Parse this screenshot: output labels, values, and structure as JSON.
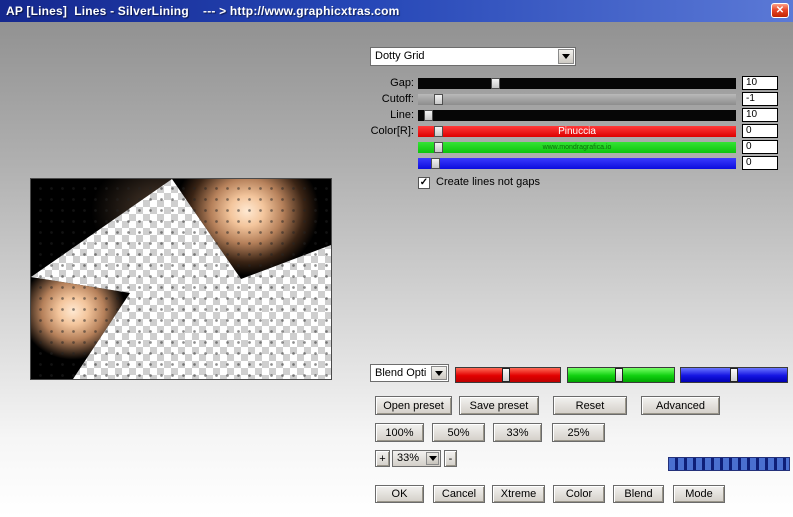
{
  "window": {
    "title": "AP [Lines]  Lines - SilverLining    --- > http://www.graphicxtras.com",
    "close_glyph": "✕"
  },
  "preset_dropdown": {
    "value": "Dotty Grid"
  },
  "sliders": {
    "rows": [
      {
        "label": "Gap:",
        "value": "10",
        "watermark": "",
        "thumb_pct": 23,
        "track_color": "#060606"
      },
      {
        "label": "Cutoff:",
        "value": "-1",
        "watermark": "",
        "thumb_pct": 5,
        "track_color": "#9a9a9a"
      },
      {
        "label": "Line:",
        "value": "10",
        "watermark": "",
        "thumb_pct": 2,
        "track_color": "#060606"
      },
      {
        "label": "Color[R]:",
        "value": "0",
        "watermark": "Pinuccia",
        "thumb_pct": 5,
        "track_color": "#e20000"
      },
      {
        "label": "",
        "value": "0",
        "watermark": "www.mondragrafica.io",
        "thumb_pct": 5,
        "track_color": "#10d010"
      },
      {
        "label": "",
        "value": "0",
        "watermark": "",
        "thumb_pct": 4,
        "track_color": "#1414e2"
      }
    ]
  },
  "options": {
    "create_lines_checkbox": "Create lines not gaps",
    "checked": true,
    "check_glyph": "✓"
  },
  "blend": {
    "dropdown_value": "Blend Opti",
    "channels": [
      {
        "name": "red",
        "color": "#e20000",
        "thumb_pct": 44
      },
      {
        "name": "green",
        "color": "#10d010",
        "thumb_pct": 44
      },
      {
        "name": "blue",
        "color": "#1414e2",
        "thumb_pct": 46
      }
    ]
  },
  "preset_buttons": {
    "open": "Open preset",
    "save": "Save preset",
    "reset": "Reset",
    "advanced": "Advanced"
  },
  "zoom_buttons": {
    "b100": "100%",
    "b50": "50%",
    "b33": "33%",
    "b25": "25%"
  },
  "zoom_stepper": {
    "plus": "+",
    "value": "33%",
    "minus": "-"
  },
  "action_buttons": {
    "ok": "OK",
    "cancel": "Cancel",
    "xtreme": "Xtreme",
    "color": "Color",
    "blend": "Blend",
    "mode": "Mode"
  }
}
